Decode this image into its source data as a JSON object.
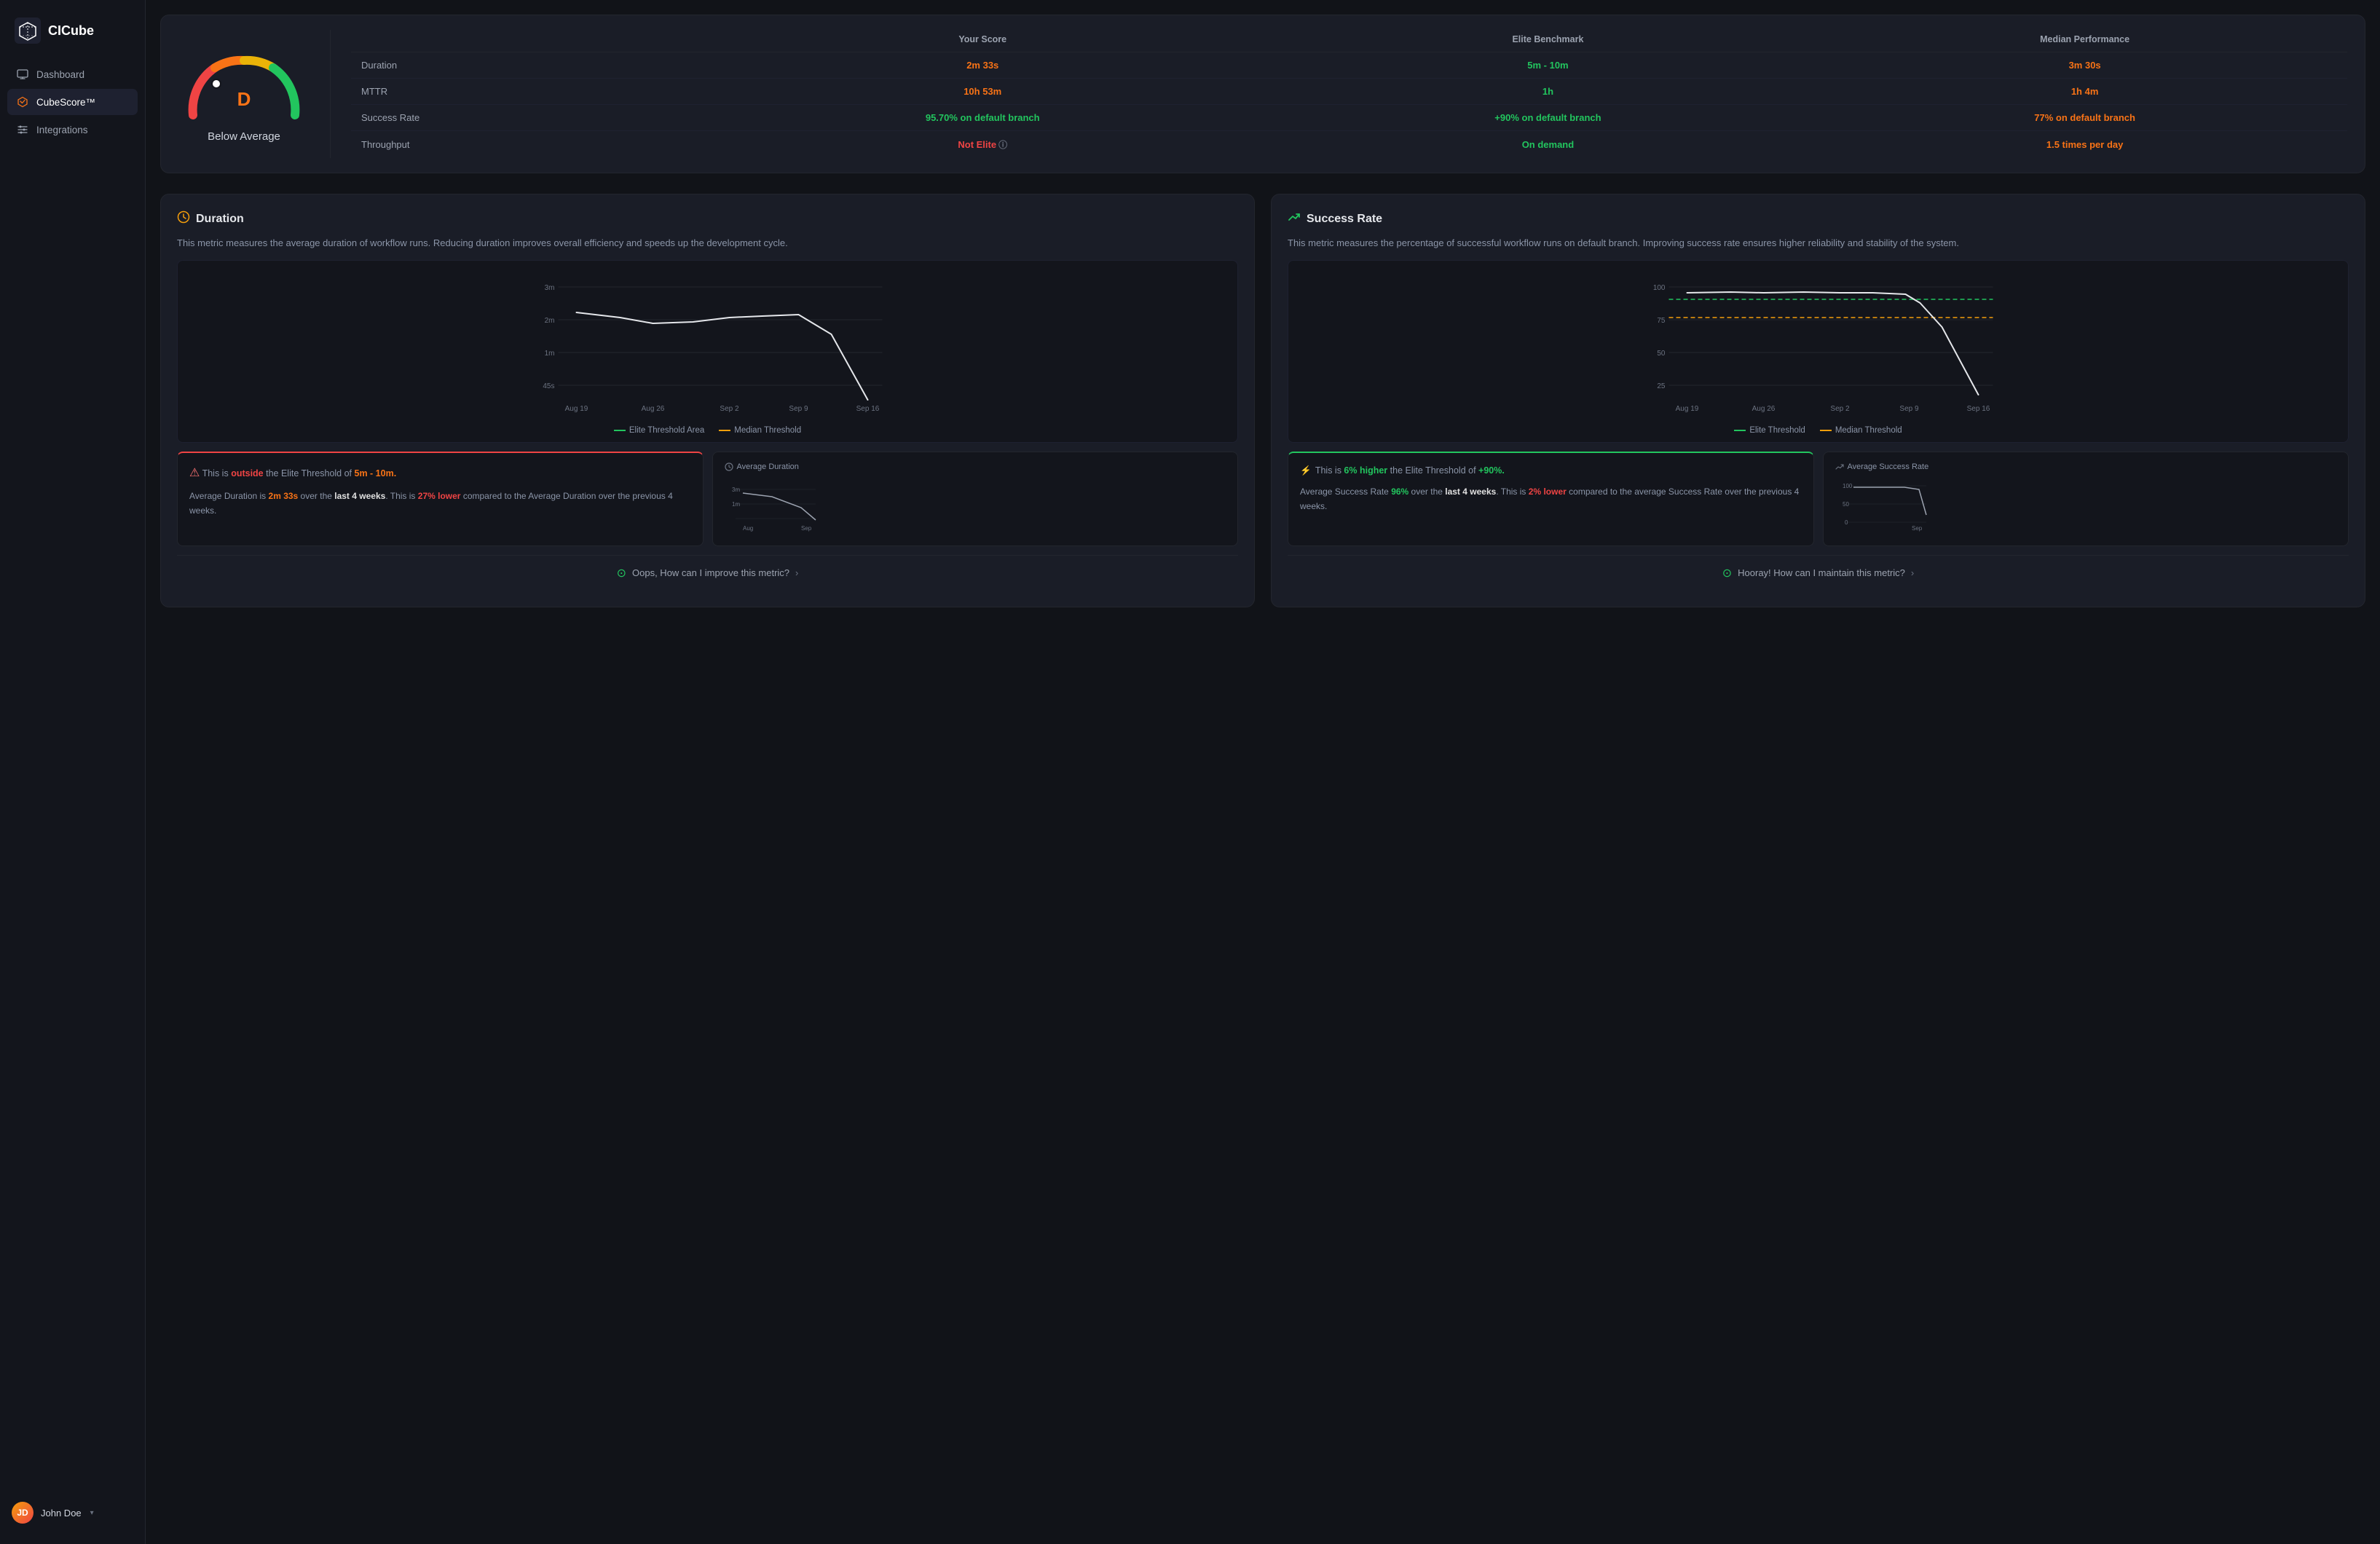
{
  "app": {
    "name": "CICube",
    "logo_alt": "cube-logo"
  },
  "sidebar": {
    "items": [
      {
        "id": "dashboard",
        "label": "Dashboard",
        "icon": "monitor",
        "active": false
      },
      {
        "id": "cubescore",
        "label": "CubeScore™",
        "icon": "hexagon",
        "active": true
      },
      {
        "id": "integrations",
        "label": "Integrations",
        "icon": "sliders",
        "active": false
      }
    ],
    "user": {
      "name": "John Doe",
      "initials": "JD"
    }
  },
  "score_panel": {
    "grade": "D",
    "label": "Below Average",
    "table": {
      "headers": [
        "",
        "Your Score",
        "Elite Benchmark",
        "Median Performance"
      ],
      "rows": [
        {
          "metric": "Duration",
          "your": "2m 33s",
          "elite": "5m - 10m",
          "median": "3m 30s",
          "your_class": "col-your",
          "elite_class": "col-elite",
          "median_class": "col-median"
        },
        {
          "metric": "MTTR",
          "your": "10h 53m",
          "elite": "1h",
          "median": "1h 4m",
          "your_class": "col-your",
          "elite_class": "col-elite",
          "median_class": "col-median"
        },
        {
          "metric": "Success Rate",
          "your": "95.70% on default branch",
          "elite": "+90% on default branch",
          "median": "77% on default branch",
          "your_class": "col-elite",
          "elite_class": "col-elite",
          "median_class": "col-median"
        },
        {
          "metric": "Throughput",
          "your": "Not Elite",
          "elite": "On demand",
          "median": "1.5 times per day",
          "your_class": "not-elite",
          "elite_class": "col-elite",
          "median_class": "col-median"
        }
      ]
    }
  },
  "duration_section": {
    "title": "Duration",
    "icon": "clock",
    "description": "This metric measures the average duration of workflow runs. Reducing duration improves overall efficiency and speeds up the development cycle.",
    "chart": {
      "x_labels": [
        "Aug 19",
        "Aug 26",
        "Sep 2",
        "Sep 9",
        "Sep 16"
      ],
      "y_labels": [
        "3m",
        "2m",
        "1m",
        "45s"
      ],
      "legend_elite": "Elite Threshold Area",
      "legend_median": "Median Threshold"
    },
    "bottom_alert": {
      "type": "danger",
      "prefix": "This is",
      "outside_text": "outside",
      "suffix_text": "the Elite Threshold of",
      "threshold": "5m - 10m."
    },
    "bottom_stat": {
      "label": "Average Duration",
      "icon": "clock",
      "value": "2m 33s",
      "period": "last 4 weeks",
      "change": "27% lower",
      "change_text": "compared to the Average Duration over the previous 4 weeks.",
      "chart_x": [
        "Aug",
        "Sep"
      ]
    },
    "improve_btn": "Oops, How can I improve this metric?"
  },
  "success_section": {
    "title": "Success Rate",
    "icon": "trending-up",
    "description": "This metric measures the percentage of successful workflow runs on default branch. Improving success rate ensures higher reliability and stability of the system.",
    "chart": {
      "x_labels": [
        "Aug 19",
        "Aug 26",
        "Sep 2",
        "Sep 9",
        "Sep 16"
      ],
      "y_labels": [
        "100",
        "75",
        "50",
        "25"
      ],
      "legend_elite": "Elite Threshold",
      "legend_median": "Median Threshold"
    },
    "bottom_alert": {
      "type": "success",
      "prefix": "This is",
      "higher_text": "6% higher",
      "suffix_text": "the Elite Threshold of",
      "threshold": "+90%."
    },
    "bottom_stat": {
      "label": "Average Success Rate",
      "icon": "trending-up",
      "value": "96",
      "period": "last 4 weeks",
      "change": "2% lower",
      "change_text": "compared to the average Success Rate over the previous 4 weeks.",
      "chart_x": [
        "Sep"
      ]
    },
    "improve_btn": "Hooray! How can I maintain this metric?"
  }
}
